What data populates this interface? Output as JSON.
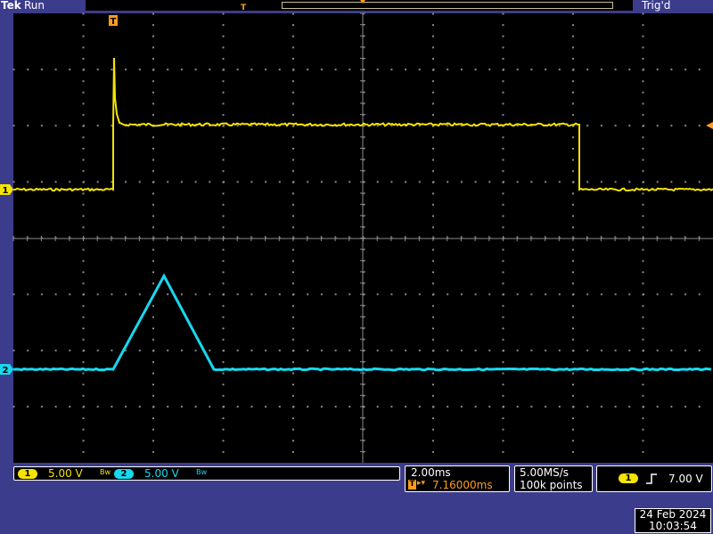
{
  "header": {
    "brand": "Tek",
    "status": "Run",
    "trigger_status": "Trig'd"
  },
  "channels": [
    {
      "id": "1",
      "scale": "5.00 V",
      "color": "#f5e400",
      "marker": "1"
    },
    {
      "id": "2",
      "scale": "5.00 V",
      "color": "#17d8ef",
      "marker": "2"
    }
  ],
  "bandwidth_icon": "Bw",
  "timebase": {
    "scale": "2.00ms",
    "trigger_position": "7.16000ms"
  },
  "acquisition": {
    "sample_rate": "5.00MS/s",
    "record_length": "100k points"
  },
  "trigger": {
    "source": "1",
    "slope": "rising-edge-icon",
    "level": "7.00 V"
  },
  "datetime": {
    "date": "24 Feb  2024",
    "time": "10:03:54"
  },
  "trigger_marker": "T",
  "colors": {
    "background": "#3c3c8c",
    "graticule": "#8a8a8a",
    "ch1": "#f5e400",
    "ch2": "#17d8ef",
    "trigger_marker": "#ff9c1f"
  }
}
